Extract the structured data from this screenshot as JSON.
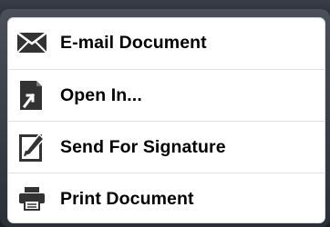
{
  "menu": {
    "items": [
      {
        "label": "E-mail Document",
        "icon": "envelope-icon"
      },
      {
        "label": "Open In...",
        "icon": "open-in-document-icon"
      },
      {
        "label": "Send For Signature",
        "icon": "pen-signature-icon"
      },
      {
        "label": "Print Document",
        "icon": "printer-icon"
      }
    ]
  },
  "colors": {
    "text": "#000000",
    "icon": "#333333",
    "divider": "#e0e0e0",
    "frame": "#2b2f38"
  }
}
